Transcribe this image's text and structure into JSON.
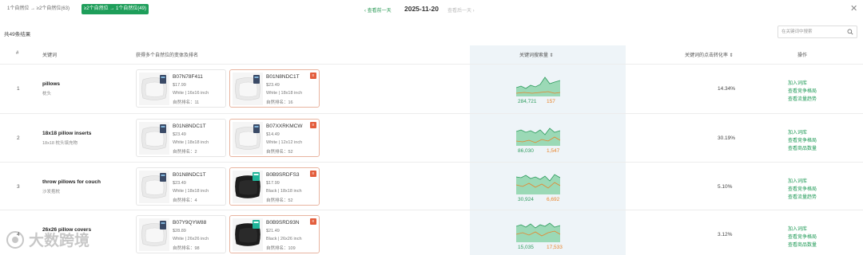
{
  "filter": {
    "segments": [
      {
        "label": "1个自然位 → ≥2个自然位(63)"
      },
      {
        "label": "≥2个自然位 → 1个自然位(49)"
      }
    ]
  },
  "date_nav": {
    "prev": "‹ 查看前一天",
    "date": "2025-11-20",
    "next": "查看后一天 ›"
  },
  "result_count": "共49条结果",
  "search": {
    "placeholder": "在关键词中搜索"
  },
  "table": {
    "headers": {
      "index": "#",
      "keyword": "关键词",
      "products": "获得多个自然位的变体及排名",
      "trend": "关键词搜索量 ⇕",
      "ctr": "关键词的点击转化率 ⇕",
      "actions": "操作"
    },
    "rows": [
      {
        "index": "1",
        "keyword": "pillows",
        "keyword_zh": "枕头",
        "card1": {
          "asin": "B07N78F411",
          "price": "$17.99",
          "variant": "White | 16x16 inch",
          "rank": "自然排名：11"
        },
        "card2": {
          "asin": "B01N8NDC1T",
          "price": "$23.49",
          "variant": "White | 18x18 inch",
          "rank": "自然排名：16"
        },
        "volume_a": "284,721",
        "volume_b": "157",
        "ctr": "14.34%",
        "actions": [
          "加入词库",
          "查看竞争格局",
          "查看流量趋势"
        ]
      },
      {
        "index": "2",
        "keyword": "18x18 pillow inserts",
        "keyword_zh": "18x18 枕头填充物",
        "card1": {
          "asin": "B01N8NDC1T",
          "price": "$23.49",
          "variant": "White | 18x18 inch",
          "rank": "自然排名：2"
        },
        "card2": {
          "asin": "B07XXRKMCW",
          "price": "$14.49",
          "variant": "White | 12x12 inch",
          "rank": "自然排名：52"
        },
        "volume_a": "86,030",
        "volume_b": "1,547",
        "ctr": "30.19%",
        "actions": [
          "加入词库",
          "查看竞争格局",
          "查看商品数量"
        ]
      },
      {
        "index": "3",
        "keyword": "throw pillows for couch",
        "keyword_zh": "沙发抱枕",
        "card1": {
          "asin": "B01N8NDC1T",
          "price": "$23.49",
          "variant": "White | 18x18 inch",
          "rank": "自然排名：4"
        },
        "card2": {
          "asin": "B0B9SRDFS3",
          "price": "$17.99",
          "variant": "Black | 18x18 inch",
          "rank": "自然排名：52"
        },
        "volume_a": "30,924",
        "volume_b": "6,692",
        "ctr": "5.10%",
        "actions": [
          "加入词库",
          "查看竞争格局",
          "查看流量趋势"
        ]
      },
      {
        "index": "4",
        "keyword": "26x26 pillow covers",
        "keyword_zh": "",
        "card1": {
          "asin": "B07Y9QYW88",
          "price": "$28.89",
          "variant": "White | 26x26 inch",
          "rank": "自然排名：98"
        },
        "card2": {
          "asin": "B0B9SRD93N",
          "price": "$21.49",
          "variant": "Black | 26x26 inch",
          "rank": "自然排名：109"
        },
        "volume_a": "15,035",
        "volume_b": "17,533",
        "ctr": "3.12%",
        "actions": [
          "加入词库",
          "查看竞争格局",
          "查看商品数量"
        ]
      }
    ]
  },
  "watermark": "大数跨境",
  "colors": {
    "accent": "#1e9e5a",
    "orange": "#e8842c",
    "flag": "#e35d3c"
  }
}
